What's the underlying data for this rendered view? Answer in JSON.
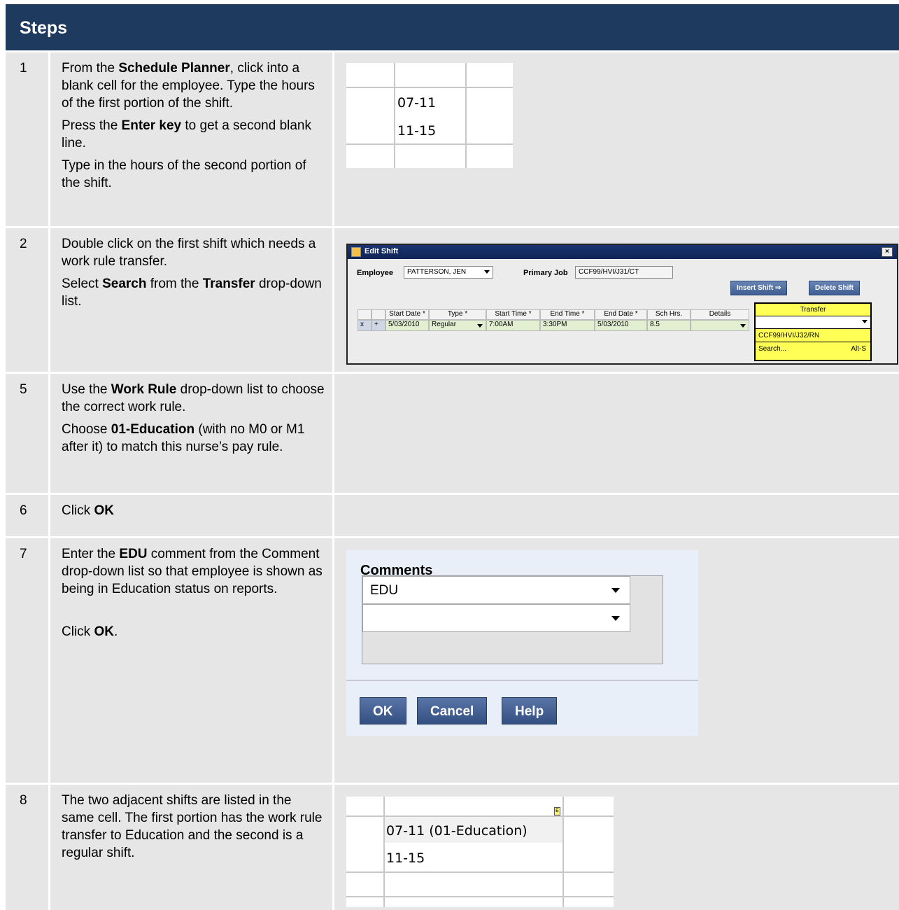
{
  "header": {
    "title": "Steps"
  },
  "steps": [
    {
      "num": "1",
      "p1": [
        "From the ",
        "Schedule Planner",
        ", click into a blank cell for the employee. Type the hours of the first portion of the shift."
      ],
      "p2": [
        "Press the ",
        "Enter key",
        " to get a second blank line."
      ],
      "p3": "Type in the hours of the second portion of the shift."
    },
    {
      "num": "2",
      "p1": "Double click on the first shift which needs a work rule transfer.",
      "p2": [
        "Select ",
        "Search",
        " from the ",
        "Transfer",
        " drop-down list."
      ]
    },
    {
      "num": "5",
      "p1": [
        "Use the ",
        "Work Rule",
        " drop-down list to choose the correct work rule."
      ],
      "p2": [
        "Choose ",
        "01-Education",
        " (with no M0 or M1 after it) to match this nurse’s pay rule."
      ]
    },
    {
      "num": "6",
      "p1": [
        "Click ",
        "OK"
      ]
    },
    {
      "num": "7",
      "p1": [
        "Enter the ",
        "EDU",
        " comment from the Comment drop-down list so that employee is shown as being in Education status on reports."
      ],
      "p2": [
        " Click ",
        "OK",
        "."
      ]
    },
    {
      "num": "8",
      "p1": "The two adjacent shifts are listed in the same cell. The first portion has the work rule transfer to Education and the second is a regular shift."
    }
  ],
  "grid1": {
    "line1": "07-11",
    "line2": "11-15"
  },
  "edit_shift": {
    "title": "Edit Shift",
    "close": "×",
    "employee_label": "Employee",
    "employee_value": "PATTERSON, JEN",
    "primary_job_label": "Primary Job",
    "primary_job_value": "CCF99/HVI/J31/CT",
    "insert_btn": "Insert Shift ⇒",
    "delete_btn": "Delete Shift",
    "columns": [
      "Start Date *",
      "Type *",
      "Start Time *",
      "End Time *",
      "End Date *",
      "Sch Hrs.",
      "Details"
    ],
    "row": [
      "5/03/2010",
      "Regular",
      "7:00AM",
      "3:30PM",
      "5/03/2010",
      "8.5",
      ""
    ],
    "transfer_header": "Transfer",
    "transfer_options": [
      "CCF99/HVI/J32/RN",
      "Search..."
    ],
    "shortcut": "Alt-S"
  },
  "comments": {
    "title": "Comments",
    "select1": "EDU",
    "select2": "",
    "ok": "OK",
    "cancel": "Cancel",
    "help": "Help"
  },
  "grid8": {
    "line1": "07-11 (01-Education)",
    "line2": "11-15",
    "memo": "E"
  }
}
